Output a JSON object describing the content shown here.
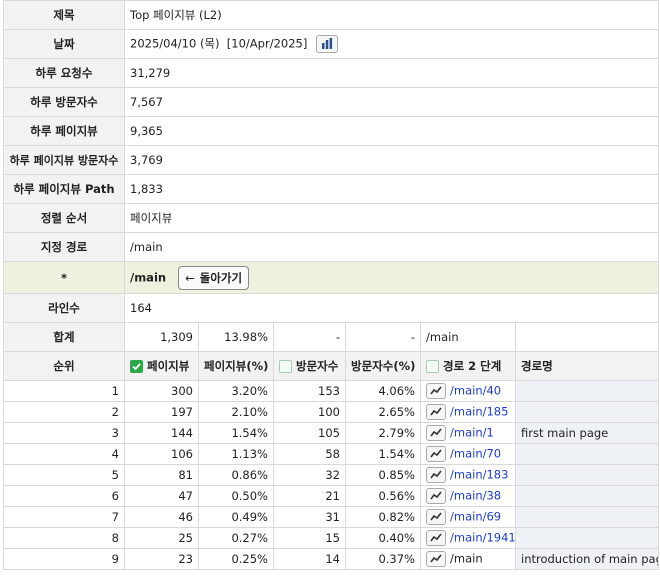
{
  "info": {
    "title_label": "제목",
    "title_value": "Top 페이지뷰 (L2)",
    "date_label": "날짜",
    "date_value": "2025/04/10 (목)  [10/Apr/2025]",
    "req_label": "하루 요청수",
    "req_value": "31,279",
    "visitors_label": "하루 방문자수",
    "visitors_value": "7,567",
    "pv_label": "하루 페이지뷰",
    "pv_value": "9,365",
    "pv_visitors_label": "하루 페이지뷰 방문자수",
    "pv_visitors_value": "3,769",
    "pv_path_label": "하루 페이지뷰 Path",
    "pv_path_value": "1,833",
    "sort_label": "정렬 순서",
    "sort_value": "페이지뷰",
    "path_label": "지정 경로",
    "path_value": "/main"
  },
  "current_path": {
    "marker": "*",
    "path": "/main",
    "back_label": "돌아가기"
  },
  "lines": {
    "label": "라인수",
    "value": "164"
  },
  "summary": {
    "label": "합계",
    "pageviews": "1,309",
    "pv_pct": "13.98%",
    "visitors": "-",
    "visitors_pct": "-",
    "path": "/main"
  },
  "header": {
    "rank": "순위",
    "pageviews": "페이지뷰",
    "pv_pct": "페이지뷰(%)",
    "visitors": "방문자수",
    "visitors_pct": "방문자수(%)",
    "step2": "경로 2 단계",
    "path_name": "경로명"
  },
  "rows": [
    {
      "rank": "1",
      "pageviews": "300",
      "pv_pct": "3.20%",
      "visitors": "153",
      "visitors_pct": "4.06%",
      "path": "/main/40",
      "name": "",
      "link": true
    },
    {
      "rank": "2",
      "pageviews": "197",
      "pv_pct": "2.10%",
      "visitors": "100",
      "visitors_pct": "2.65%",
      "path": "/main/185",
      "name": "",
      "link": true
    },
    {
      "rank": "3",
      "pageviews": "144",
      "pv_pct": "1.54%",
      "visitors": "105",
      "visitors_pct": "2.79%",
      "path": "/main/1",
      "name": "first main page",
      "link": true
    },
    {
      "rank": "4",
      "pageviews": "106",
      "pv_pct": "1.13%",
      "visitors": "58",
      "visitors_pct": "1.54%",
      "path": "/main/70",
      "name": "",
      "link": true
    },
    {
      "rank": "5",
      "pageviews": "81",
      "pv_pct": "0.86%",
      "visitors": "32",
      "visitors_pct": "0.85%",
      "path": "/main/183",
      "name": "",
      "link": true
    },
    {
      "rank": "6",
      "pageviews": "47",
      "pv_pct": "0.50%",
      "visitors": "21",
      "visitors_pct": "0.56%",
      "path": "/main/38",
      "name": "",
      "link": true
    },
    {
      "rank": "7",
      "pageviews": "46",
      "pv_pct": "0.49%",
      "visitors": "31",
      "visitors_pct": "0.82%",
      "path": "/main/69",
      "name": "",
      "link": true
    },
    {
      "rank": "8",
      "pageviews": "25",
      "pv_pct": "0.27%",
      "visitors": "15",
      "visitors_pct": "0.40%",
      "path": "/main/1941",
      "name": "",
      "link": true
    },
    {
      "rank": "9",
      "pageviews": "23",
      "pv_pct": "0.25%",
      "visitors": "14",
      "visitors_pct": "0.37%",
      "path": "/main",
      "name": "introduction of main page",
      "link": false
    }
  ]
}
